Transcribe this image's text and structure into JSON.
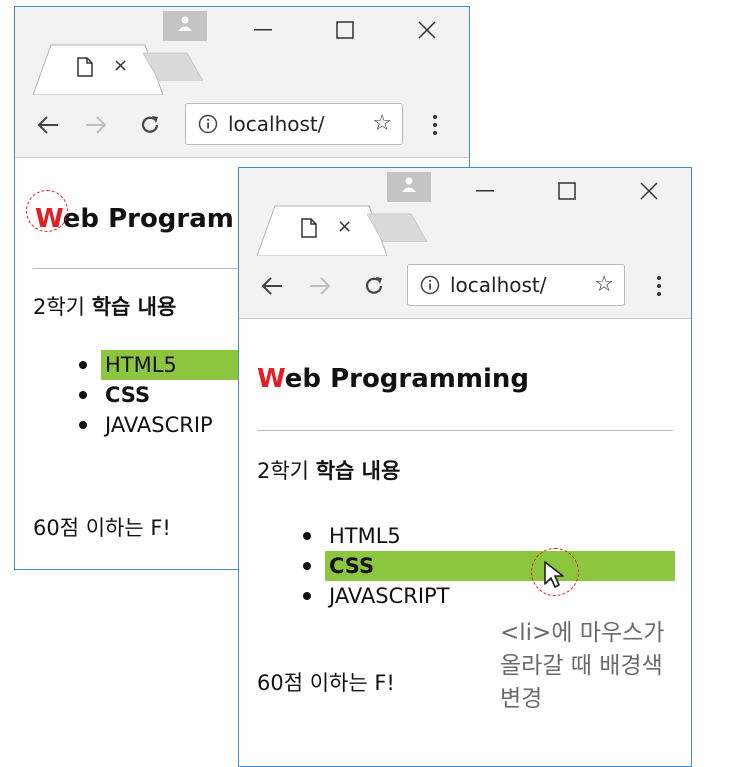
{
  "browser": {
    "tab_close_glyph": "×",
    "address_text": "localhost/",
    "icons": [
      "page-icon",
      "profile-icon",
      "minimize-icon",
      "maximize-icon",
      "close-icon",
      "back-icon",
      "forward-icon",
      "reload-icon",
      "info-icon",
      "star-icon",
      "menu-icon"
    ]
  },
  "window_back": {
    "address_text": "localhost/",
    "title_first_letter": "W",
    "title_rest": "eb Program",
    "subtitle_prefix": "2학기 ",
    "subtitle_bold": "학습 내용",
    "items": [
      "HTML5",
      "CSS",
      "JAVASCRIP"
    ],
    "highlighted_item_index": 0,
    "note": "60점 이하는 F!"
  },
  "window_front": {
    "address_text": "localhost/",
    "title_first_letter": "W",
    "title_rest": "eb Programming",
    "subtitle_prefix": "2학기 ",
    "subtitle_bold": "학습 내용",
    "items": [
      "HTML5",
      "CSS",
      "JAVASCRIPT"
    ],
    "highlighted_item_index": 1,
    "note": "60점 이하는 F!"
  },
  "callout": {
    "line1": "<li>에 마우스가",
    "line2": "올라갈 때  배경색",
    "line3": "변경"
  },
  "colors": {
    "window_border": "#3c8ed6",
    "accent_red": "#e31e24",
    "highlight_green": "#8cc63f",
    "chrome_gray": "#f2f2f2"
  }
}
